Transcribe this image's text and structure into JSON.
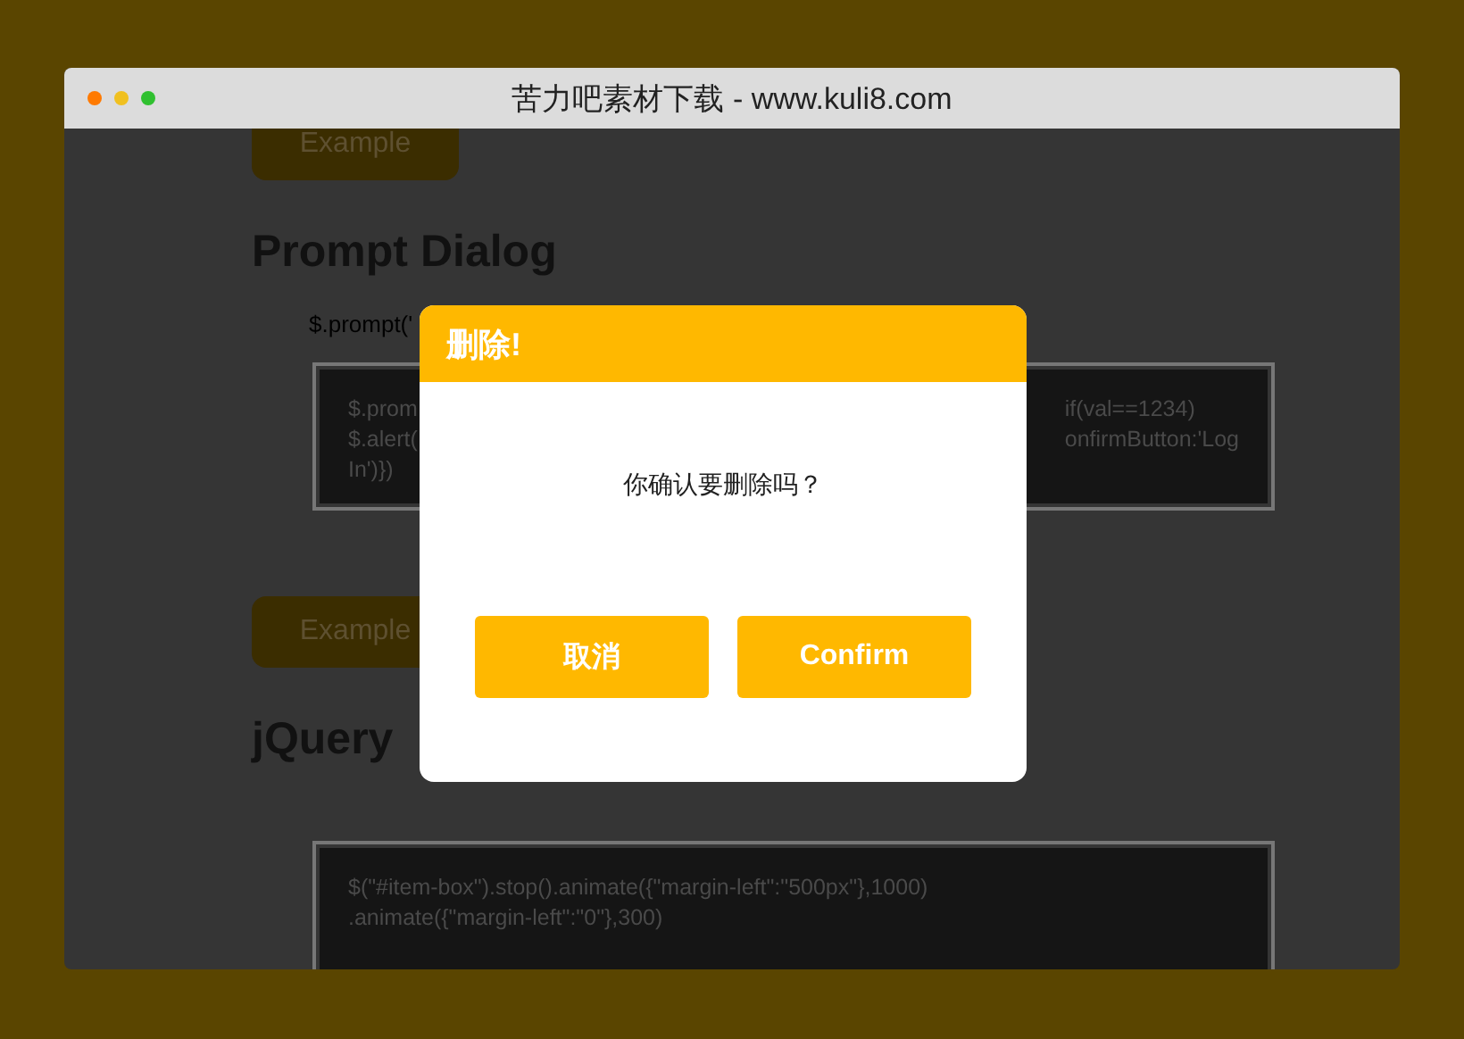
{
  "window": {
    "title": "苦力吧素材下载 - www.kuli8.com"
  },
  "page": {
    "sections": [
      {
        "kind": "button",
        "label": "Example"
      },
      {
        "kind": "heading",
        "text": "Prompt Dialog"
      },
      {
        "kind": "line",
        "text": "$.prompt('"
      },
      {
        "kind": "code",
        "left": [
          "$.prom",
          "$.alert(",
          "In')})"
        ],
        "right": [
          "if(val==1234)",
          "onfirmButton:'Log"
        ]
      },
      {
        "kind": "button",
        "label": "Example"
      },
      {
        "kind": "heading",
        "text": "jQuery"
      },
      {
        "kind": "code",
        "left": [
          "$(\"#item-box\").stop().animate({\"margin-left\":\"500px\"},1000)",
          ".animate({\"margin-left\":\"0\"},300)"
        ]
      }
    ]
  },
  "dialog": {
    "title": "删除!",
    "message": "你确认要删除吗？",
    "buttons": [
      "取消",
      "Confirm"
    ]
  }
}
